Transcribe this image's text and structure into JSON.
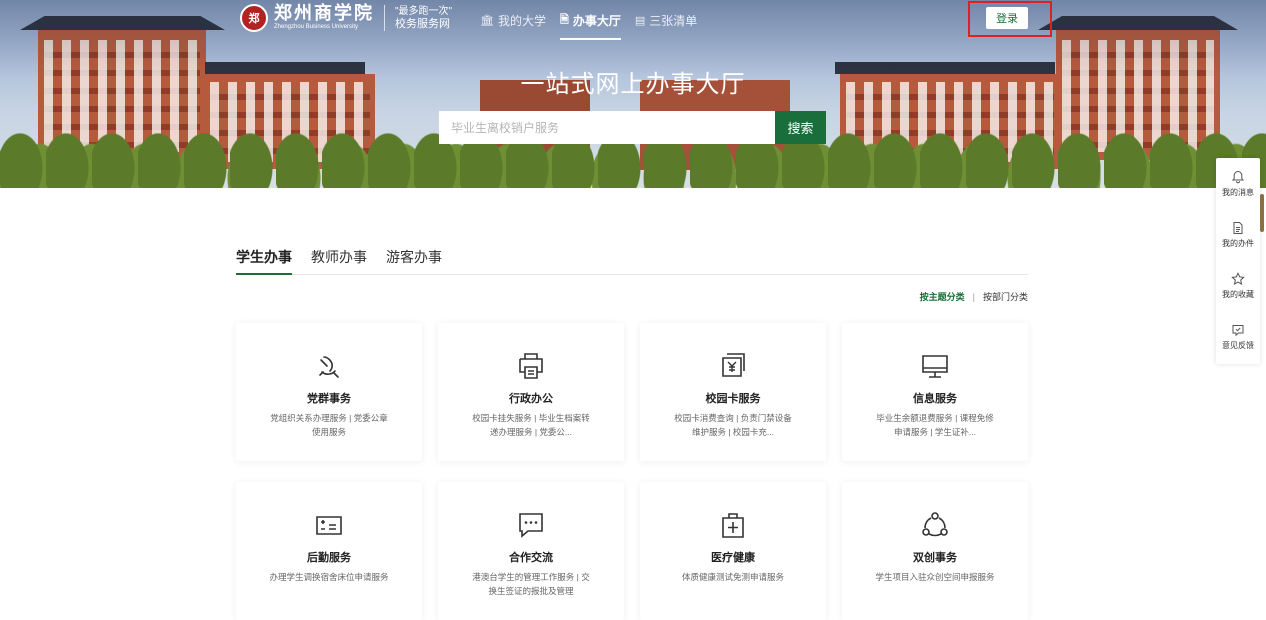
{
  "header": {
    "logo_seal_text": "郑",
    "school_name": "郑州商学院",
    "school_name_en": "Zhengzhou Business University",
    "slogan_line1": "\"最多跑一次\"",
    "slogan_line2": "校务服务网",
    "nav": [
      {
        "label": "我的大学",
        "icon": "university-icon",
        "active": false
      },
      {
        "label": "办事大厅",
        "icon": "hall-icon",
        "active": true
      },
      {
        "label": "三张清单",
        "icon": "list-icon",
        "active": false
      }
    ],
    "login_label": "登录"
  },
  "hero": {
    "title": "一站式网上办事大厅",
    "search_placeholder": "毕业生离校销户服务",
    "search_button": "搜索"
  },
  "side_toolbar": [
    {
      "label": "我的消息",
      "icon": "bell-icon"
    },
    {
      "label": "我的办件",
      "icon": "document-icon"
    },
    {
      "label": "我的收藏",
      "icon": "star-icon"
    },
    {
      "label": "意见反馈",
      "icon": "feedback-icon"
    }
  ],
  "tabs": [
    {
      "label": "学生办事",
      "active": true
    },
    {
      "label": "教师办事",
      "active": false
    },
    {
      "label": "游客办事",
      "active": false
    }
  ],
  "classify": {
    "by_theme": "按主题分类",
    "separator": "|",
    "by_dept": "按部门分类"
  },
  "cards": [
    {
      "title": "党群事务",
      "desc": "党组织关系办理服务 | 党委公章使用服务",
      "icon": "party-emblem-icon"
    },
    {
      "title": "行政办公",
      "desc": "校园卡挂失服务 | 毕业生档案转递办理服务 | 党委公...",
      "icon": "printer-icon"
    },
    {
      "title": "校园卡服务",
      "desc": "校园卡消费查询 | 负责门禁设备维护服务 | 校园卡充...",
      "icon": "yen-card-icon"
    },
    {
      "title": "信息服务",
      "desc": "毕业生余额退费服务 | 课程免修申请服务 | 学生证补...",
      "icon": "monitor-icon"
    },
    {
      "title": "后勤服务",
      "desc": "办理学生调换宿舍床位申请服务",
      "icon": "calculator-icon"
    },
    {
      "title": "合作交流",
      "desc": "港澳台学生的管理工作服务 | 交换生签证的报批及管理",
      "icon": "chat-icon"
    },
    {
      "title": "医疗健康",
      "desc": "体质健康测试免测申请服务",
      "icon": "medical-kit-icon"
    },
    {
      "title": "双创事务",
      "desc": "学生项目入驻众创空间申报服务",
      "icon": "network-icon"
    }
  ]
}
